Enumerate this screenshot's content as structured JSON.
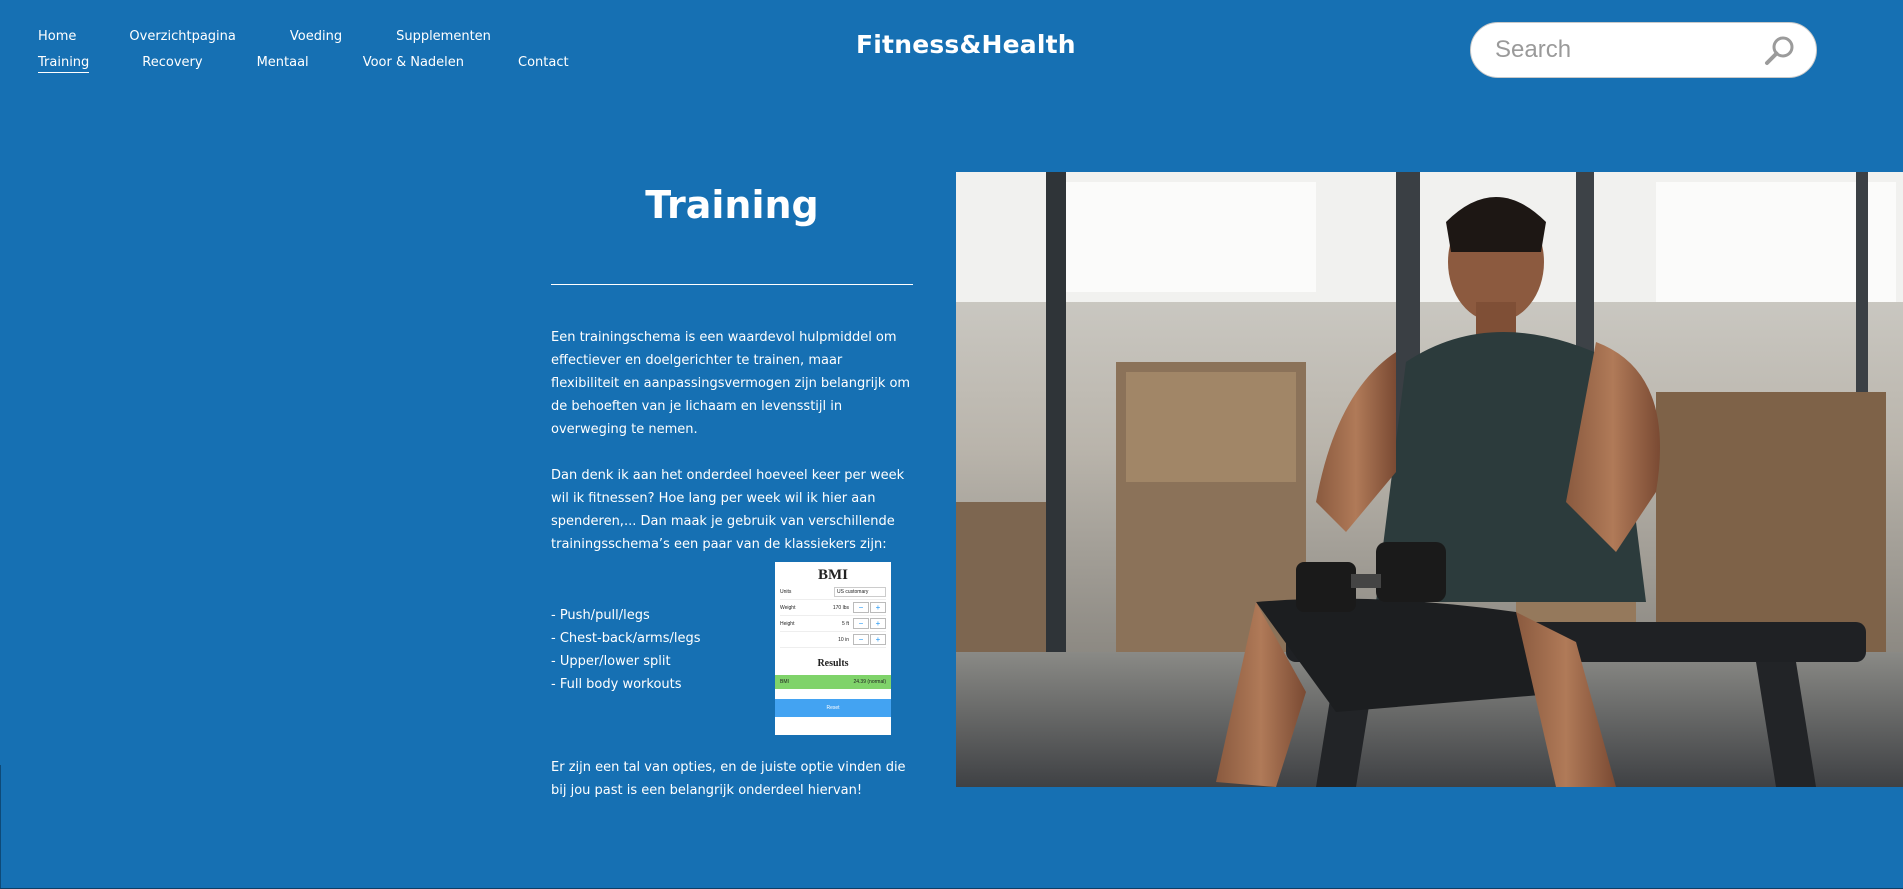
{
  "brand": "Fitness&Health",
  "nav": {
    "row1": [
      "Home",
      "Overzichtpagina",
      "Voeding",
      "Supplementen"
    ],
    "row2": [
      "Training",
      "Recovery",
      "Mentaal",
      "Voor & Nadelen",
      "Contact"
    ],
    "active": "Training"
  },
  "search": {
    "placeholder": "Search"
  },
  "page": {
    "title": "Training",
    "paragraph1": "Een trainingschema is een waardevol hulpmiddel om effectiever en doelgerichter te trainen, maar flexibiliteit en aanpassingsvermogen zijn belangrijk om de behoeften van je lichaam en levensstijl in overweging te nemen.",
    "paragraph2": "Dan denk ik aan het onderdeel hoeveel keer per week wil ik fitnessen? Hoe lang per week wil ik hier aan spenderen,... Dan maak je gebruik van verschillende trainingsschema’s een paar van de klassiekers zijn:",
    "list": [
      "- Push/pull/legs",
      "- Chest-back/arms/legs",
      "- Upper/lower split",
      "- Full body workouts"
    ],
    "paragraph3": "Er zijn een tal van opties, en de juiste optie vinden die bij jou past is een belangrijk onderdeel hiervan!"
  },
  "bmi": {
    "title": "BMI",
    "units_label": "Units",
    "units_value": "US customary",
    "weight_label": "Weight",
    "weight_value": "170 lbs",
    "height_label": "Height",
    "height_ft": "5 ft",
    "height_in": "10 in",
    "results_title": "Results",
    "result_label": "BMI",
    "result_value": "24.39 (normal)",
    "reset_label": "Reset"
  },
  "colors": {
    "background": "#1670b3",
    "text": "#ffffff"
  },
  "icons": {
    "search": "magnifier-icon"
  }
}
